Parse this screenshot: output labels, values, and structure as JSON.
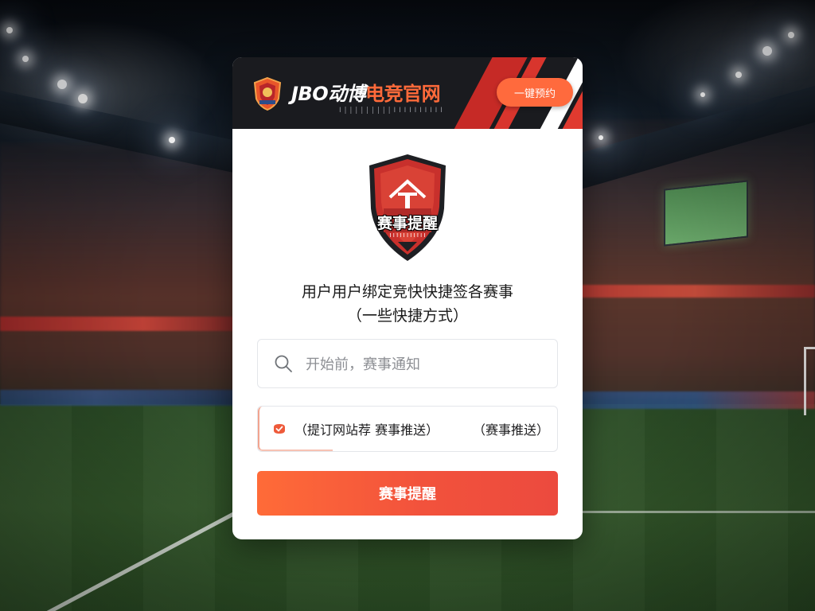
{
  "header": {
    "brand_main": "JBO",
    "brand_cn": "动博",
    "brand_highlight": "电竞官网",
    "brand_sub": "I | | | | | | | | |  I I I I I I I I I I",
    "action_button": "一键预约"
  },
  "badge": {
    "title": "赛事提醒",
    "subtitle": "I I I I I I I I I I I"
  },
  "description": {
    "line1": "用户用户绑定竞快快捷签各赛事",
    "line2": "（一些快捷方式）"
  },
  "search": {
    "placeholder": "开始前，赛事通知"
  },
  "subscribe": {
    "label": "（提订网站荐  赛事推送）",
    "right_label": "（赛事推送）"
  },
  "cta": {
    "label": "赛事提醒"
  },
  "colors": {
    "accent": "#ff6a3d",
    "cta_start": "#ff6b38",
    "cta_end": "#ec4a3e",
    "header_bg": "#1a1b1f",
    "stripe_red": "#c62a26"
  },
  "icons": {
    "brand_logo": "brand-shield-logo",
    "badge": "event-reminder-shield-icon",
    "search": "search-icon",
    "subscribe": "bell-check-icon"
  }
}
